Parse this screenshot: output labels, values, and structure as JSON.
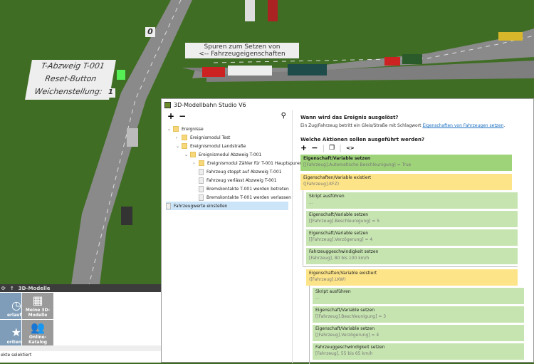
{
  "scene": {
    "signs": {
      "junction_name": "T-Abzweig T-001",
      "reset": "Reset-Button",
      "switch_label": "Weichenstellung:",
      "switch_value": "1",
      "counter": "0",
      "lanes_line1": "Spuren zum Setzen von",
      "lanes_line2": "<--  Fahrzeugeigenschaften"
    }
  },
  "window": {
    "title": "3D-Modellbahn Studio V6",
    "tree": {
      "add": "+",
      "remove": "−",
      "search_icon": "magnifier-icon",
      "items": [
        {
          "label": "Ereignisse",
          "type": "folder",
          "expanded": true
        },
        {
          "label": "Ereignismodul Test",
          "type": "folder",
          "expanded": false
        },
        {
          "label": "Ereignismodul Landstraße",
          "type": "folder",
          "expanded": true
        },
        {
          "label": "Ereignismodul Abzweig T-001",
          "type": "folder",
          "expanded": true
        },
        {
          "label": "Ereignismodul Zähler für T-001 Hauptspuren",
          "type": "folder",
          "expanded": false
        },
        {
          "label": "Fahrzeug stoppt auf Abzweig T-001",
          "type": "event"
        },
        {
          "label": "Fahrzeug verlässt Abzweig T-001",
          "type": "event"
        },
        {
          "label": "Bremskontakte T-001 werden betreten",
          "type": "event"
        },
        {
          "label": "Bremskontakte T-001 werden verlassen",
          "type": "event"
        },
        {
          "label": "Fahrzeugwerte einstellen",
          "type": "event",
          "selected": true
        }
      ]
    },
    "detail": {
      "trigger_heading": "Wann wird das Ereignis ausgelöst?",
      "trigger_text": "Ein Zug/Fahrzeug betritt ein Gleis/Straße mit Schlagwort ",
      "trigger_link": "Eigenschaften von Fahrzeugen setzen",
      "trigger_end": ".",
      "actions_heading": "Welche Aktionen sollen ausgeführt werden?",
      "toolbar": {
        "add": "+",
        "remove": "−",
        "copy_icon": "copy-icon",
        "code": "<>"
      },
      "actions": [
        {
          "title": "Eigenschaft/Variable setzen",
          "sub": "[[Fahrzeug].Automatische Beschleunigung] = True",
          "kind": "set"
        },
        {
          "title": "Eigenschaften/Variable existiert",
          "sub": "([Fahrzeug].KFZ)",
          "kind": "condition"
        },
        {
          "title": "Skript ausführen",
          "sub": "...",
          "kind": "script"
        },
        {
          "title": "Eigenschaft/Variable setzen",
          "sub": "[[Fahrzeug].Beschleunigung] = 5",
          "kind": "set"
        },
        {
          "title": "Eigenschaft/Variable setzen",
          "sub": "[[Fahrzeug].Verzögerung] = 4",
          "kind": "set"
        },
        {
          "title": "Fahrzeuggeschwindigkeit setzen",
          "sub": "[Fahrzeug], 80 bis 100 km/h",
          "kind": "speed"
        },
        {
          "title": "Eigenschaften/Variable existiert",
          "sub": "([Fahrzeug].LKW)",
          "kind": "condition"
        },
        {
          "title": "Skript ausführen",
          "sub": "...",
          "kind": "script"
        },
        {
          "title": "Eigenschaft/Variable setzen",
          "sub": "[[Fahrzeug].Beschleunigung] = 3",
          "kind": "set"
        },
        {
          "title": "Eigenschaft/Variable setzen",
          "sub": "[[Fahrzeug].Verzögerung] = 4",
          "kind": "set"
        },
        {
          "title": "Fahrzeuggeschwindigkeit setzen",
          "sub": "[Fahrzeug], 55 bis 65 km/h",
          "kind": "speed"
        }
      ]
    },
    "colors": {
      "set_bold": "#9fd37a",
      "action": "#c6e4b0",
      "condition": "#fde489",
      "selection": "#cce4f7"
    }
  },
  "catalog": {
    "title": "3D-Modelle",
    "tiles": [
      {
        "label": "erlauf",
        "icon": "clock-icon"
      },
      {
        "label": "Meine 3D-Modelle",
        "icon": "grid-icon"
      },
      {
        "label": "oriten",
        "icon": "star-icon"
      },
      {
        "label": "Online-Katalog",
        "icon": "people-icon"
      }
    ],
    "status": "ekte selektiert"
  }
}
